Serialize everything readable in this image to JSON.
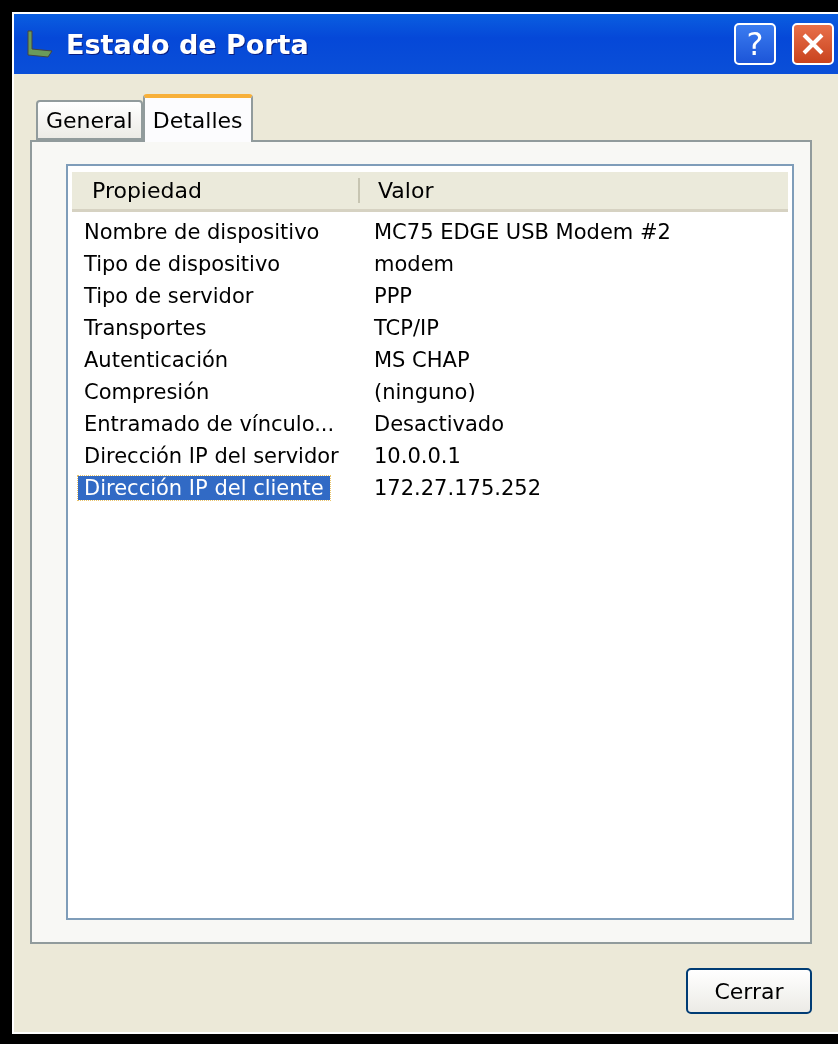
{
  "window": {
    "title": "Estado de Porta",
    "buttons": [
      {
        "kind": "help",
        "label": "?"
      },
      {
        "kind": "close"
      }
    ]
  },
  "tabs": [
    {
      "label": "General",
      "selected": false
    },
    {
      "label": "Detalles",
      "selected": true
    }
  ],
  "list": {
    "columns": [
      "Propiedad",
      "Valor"
    ],
    "rows": [
      {
        "property": "Nombre de dispositivo",
        "value": "MC75 EDGE USB Modem #2",
        "selected": false
      },
      {
        "property": "Tipo de dispositivo",
        "value": "modem",
        "selected": false
      },
      {
        "property": "Tipo de servidor",
        "value": "PPP",
        "selected": false
      },
      {
        "property": "Transportes",
        "value": "TCP/IP",
        "selected": false
      },
      {
        "property": "Autenticación",
        "value": "MS CHAP",
        "selected": false
      },
      {
        "property": "Compresión",
        "value": "(ninguno)",
        "selected": false
      },
      {
        "property": "Entramado de vínculo...",
        "value": "Desactivado",
        "selected": false
      },
      {
        "property": "Dirección IP del servidor",
        "value": "10.0.0.1",
        "selected": false
      },
      {
        "property": "Dirección IP del cliente",
        "value": "172.27.175.252",
        "selected": true
      }
    ]
  },
  "buttons": [
    "Cerrar"
  ]
}
